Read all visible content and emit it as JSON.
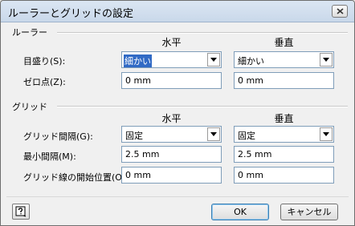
{
  "window": {
    "title": "ルーラーとグリッドの設定"
  },
  "ruler": {
    "section_title": "ルーラー",
    "col_horizontal": "水平",
    "col_vertical": "垂直",
    "subdivisions": {
      "label": "目盛り(S):",
      "horizontal": "細かい",
      "vertical": "細かい"
    },
    "zero_point": {
      "label": "ゼロ点(Z):",
      "horizontal": "0 mm",
      "vertical": "0 mm"
    }
  },
  "grid": {
    "section_title": "グリッド",
    "col_horizontal": "水平",
    "col_vertical": "垂直",
    "spacing": {
      "label": "グリッド間隔(G):",
      "horizontal": "固定",
      "vertical": "固定"
    },
    "min_spacing": {
      "label": "最小間隔(M):",
      "horizontal": "2.5 mm",
      "vertical": "2.5 mm"
    },
    "origin": {
      "label": "グリッド線の開始位置(O):",
      "horizontal": "0 mm",
      "vertical": "0 mm"
    }
  },
  "footer": {
    "ok_label": "OK",
    "cancel_label": "キャンセル",
    "help_icon": "help-icon"
  },
  "colors": {
    "selection": "#316ac5",
    "field_border": "#7f9db9"
  }
}
